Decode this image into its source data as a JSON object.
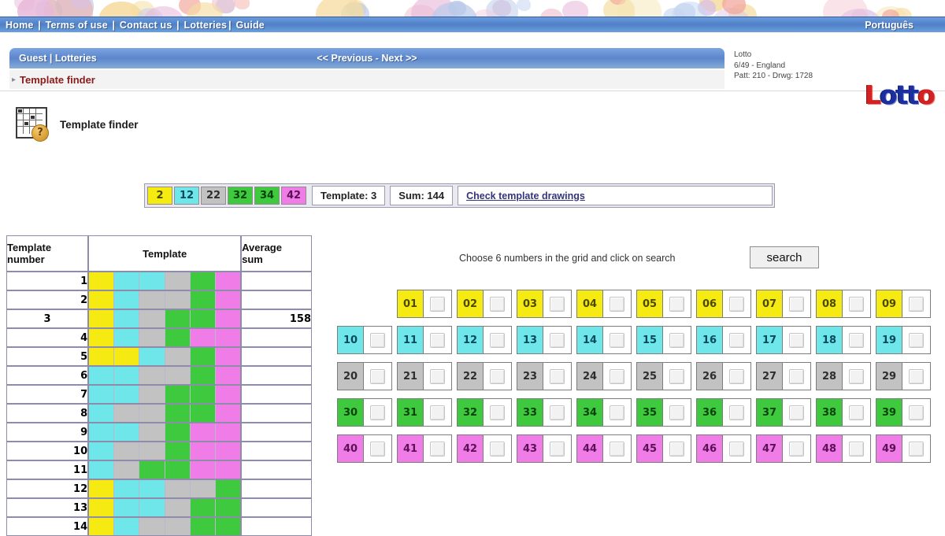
{
  "topnav": {
    "items": [
      "Home",
      "Terms of use",
      "Contact us",
      "Lotteries",
      "Guide"
    ],
    "language": "Português"
  },
  "header": {
    "breadcrumb": "Guest | Lotteries",
    "prev_next": "<< Previous - Next >>",
    "sub_breadcrumb": "Template finder",
    "lottery_name": "Lotto",
    "lottery_game": "6/49 - England",
    "lottery_stats": "Patt: 210 - Drwg: 1728",
    "logo_first": "L",
    "logo_mid": "ott",
    "logo_last": "o"
  },
  "section": {
    "icon_label": "?",
    "title": "Template finder"
  },
  "summary": {
    "numbers": [
      {
        "value": "2",
        "color": "yellow"
      },
      {
        "value": "12",
        "color": "cyan"
      },
      {
        "value": "22",
        "color": "gray"
      },
      {
        "value": "32",
        "color": "green"
      },
      {
        "value": "34",
        "color": "green"
      },
      {
        "value": "42",
        "color": "pink"
      }
    ],
    "template_label": "Template: 3",
    "sum_label": "Sum: 144",
    "check_link": "Check template drawings"
  },
  "table": {
    "headers": {
      "number": "Template\nnumber",
      "template": "Template",
      "average": "Average\nsum"
    },
    "header_number_line1": "Template",
    "header_number_line2": "number",
    "header_template": "Template",
    "header_avg_line1": "Average",
    "header_avg_line2": "sum",
    "rows": [
      {
        "n": "1",
        "avg": "",
        "cells": [
          "yellow",
          "cyan",
          "cyan",
          "gray",
          "green",
          "pink"
        ]
      },
      {
        "n": "2",
        "avg": "",
        "cells": [
          "yellow",
          "cyan",
          "gray",
          "gray",
          "green",
          "pink"
        ]
      },
      {
        "n": "3",
        "avg": "158",
        "cells": [
          "yellow",
          "cyan",
          "gray",
          "green",
          "green",
          "pink"
        ],
        "highlight": true
      },
      {
        "n": "4",
        "avg": "",
        "cells": [
          "yellow",
          "cyan",
          "gray",
          "green",
          "pink",
          "pink"
        ]
      },
      {
        "n": "5",
        "avg": "",
        "cells": [
          "yellow",
          "yellow",
          "cyan",
          "gray",
          "green",
          "pink"
        ]
      },
      {
        "n": "6",
        "avg": "",
        "cells": [
          "cyan",
          "cyan",
          "gray",
          "gray",
          "green",
          "pink"
        ]
      },
      {
        "n": "7",
        "avg": "",
        "cells": [
          "cyan",
          "cyan",
          "gray",
          "green",
          "green",
          "pink"
        ]
      },
      {
        "n": "8",
        "avg": "",
        "cells": [
          "cyan",
          "gray",
          "gray",
          "green",
          "green",
          "pink"
        ]
      },
      {
        "n": "9",
        "avg": "",
        "cells": [
          "cyan",
          "cyan",
          "gray",
          "green",
          "pink",
          "pink"
        ]
      },
      {
        "n": "10",
        "avg": "",
        "cells": [
          "cyan",
          "gray",
          "gray",
          "green",
          "pink",
          "pink"
        ]
      },
      {
        "n": "11",
        "avg": "",
        "cells": [
          "cyan",
          "gray",
          "green",
          "green",
          "pink",
          "pink"
        ]
      },
      {
        "n": "12",
        "avg": "",
        "cells": [
          "yellow",
          "cyan",
          "cyan",
          "gray",
          "gray",
          "green"
        ]
      },
      {
        "n": "13",
        "avg": "",
        "cells": [
          "yellow",
          "cyan",
          "cyan",
          "gray",
          "green",
          "green"
        ]
      },
      {
        "n": "14",
        "avg": "",
        "cells": [
          "yellow",
          "cyan",
          "gray",
          "gray",
          "green",
          "green"
        ]
      }
    ]
  },
  "picker": {
    "instruction": "Choose 6 numbers in the grid and click on search",
    "search_label": "search",
    "rows": [
      {
        "color": "yellow",
        "lead_empty": 1,
        "numbers": [
          "01",
          "02",
          "03",
          "04",
          "05",
          "06",
          "07",
          "08",
          "09"
        ]
      },
      {
        "color": "cyan",
        "lead_empty": 0,
        "numbers": [
          "10",
          "11",
          "12",
          "13",
          "14",
          "15",
          "16",
          "17",
          "18",
          "19"
        ]
      },
      {
        "color": "gray",
        "lead_empty": 0,
        "numbers": [
          "20",
          "21",
          "22",
          "23",
          "24",
          "25",
          "26",
          "27",
          "28",
          "29"
        ]
      },
      {
        "color": "green",
        "lead_empty": 0,
        "numbers": [
          "30",
          "31",
          "32",
          "33",
          "34",
          "35",
          "36",
          "37",
          "38",
          "39"
        ]
      },
      {
        "color": "pink",
        "lead_empty": 0,
        "numbers": [
          "40",
          "41",
          "42",
          "43",
          "44",
          "45",
          "46",
          "47",
          "48",
          "49"
        ]
      }
    ]
  },
  "colors": {
    "yellow": "#f5eb13",
    "cyan": "#6fe6ea",
    "gray": "#c2c2c2",
    "green": "#3ec93e",
    "pink": "#f07ce8",
    "nav_blue": "#4f80c8",
    "crumb_red": "#8b1a1a",
    "link_blue": "#33347a"
  }
}
